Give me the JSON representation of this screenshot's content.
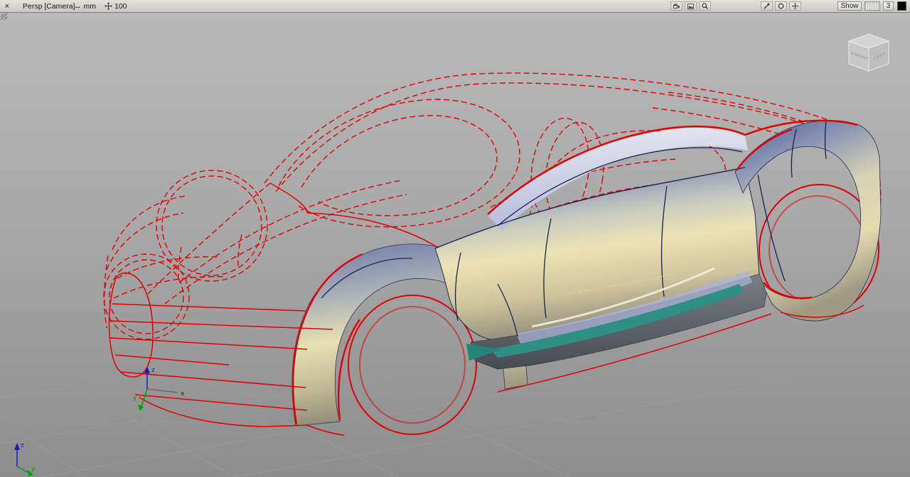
{
  "toolbar": {
    "view_label": "Persp [Camera]",
    "units": "mm",
    "grid_size": "100",
    "show_label": "Show",
    "panel_count": "3"
  },
  "icons": {
    "close": "×",
    "resize_arrows": "↔"
  },
  "viewcube": {
    "front_label": "FRONT",
    "left_label": "LEFT"
  },
  "axes": {
    "x": "x",
    "y": "y",
    "z": "z"
  },
  "colors": {
    "wireframe_red": "#e30000",
    "seam_blue": "#1b2150",
    "surface_blue_top": "#5c6a9e",
    "surface_gold": "#ece3b4",
    "sill_teal": "#2e8f85",
    "background_top": "#bababa",
    "background_bottom": "#8d8d8d",
    "toolbar_bg": "#d6d3ce",
    "swatch_black": "#060606"
  }
}
